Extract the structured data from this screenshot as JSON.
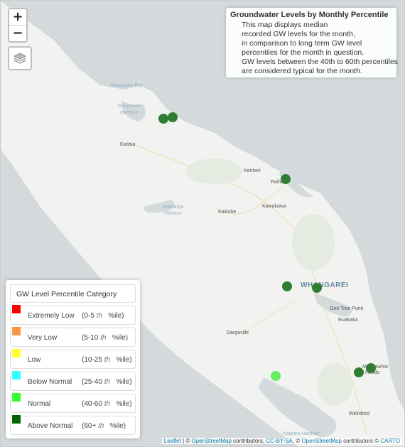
{
  "map": {
    "zoom_in": "+",
    "zoom_out": "−",
    "layers_icon": "layers-icon",
    "places": {
      "rangaunu_bay": "Rangaunu Bay",
      "rangaunu_harbour_1": "Rangaunu",
      "rangaunu_harbour_2": "Harbour",
      "kaitaia": "Kaitaia",
      "kerikeri": "Kerikeri",
      "paihia": "Paihia",
      "kawakawa": "Kawakawa",
      "kaikohe": "Kaikohe",
      "hokianga_harbour_1": "Hokianga",
      "hokianga_harbour_2": "Harbour",
      "whangarei": "WHANGAREI",
      "one_tree_point": "One Tree Point",
      "ruakaka": "Ruakaka",
      "dargaville": "Dargaville",
      "mangawhai_heads_1": "Mangawhai",
      "mangawhai_heads_2": "Heads",
      "wellsford": "Wellsford",
      "kaipara_harbour": "Kaipara Harbour"
    }
  },
  "info": {
    "title": "Groundwater Levels by Monthly Percentile",
    "lines": [
      "This map displays median",
      "recorded GW levels for the month,",
      "in comparison to long term GW level",
      "percentiles for the month in question.",
      "GW levels between the 40th to 60th percentiles",
      "are considered typical for the month."
    ]
  },
  "legend": {
    "title": "GW Level Percentile Category",
    "items": [
      {
        "label": "Extremely Low",
        "range_a": "(0-5",
        "range_th": "th",
        "range_b": "%ile)",
        "color": "#ff0000"
      },
      {
        "label": "Very Low",
        "range_a": "(5-10",
        "range_th": "th",
        "range_b": "%ile)",
        "color": "#f79646"
      },
      {
        "label": "Low",
        "range_a": "(10-25",
        "range_th": "th",
        "range_b": "%ile)",
        "color": "#ffff33"
      },
      {
        "label": "Below Normal",
        "range_a": "(25-40",
        "range_th": "th",
        "range_b": "%ile)",
        "color": "#33ffff"
      },
      {
        "label": "Normal",
        "range_a": "(40-60",
        "range_th": "th",
        "range_b": "%ile)",
        "color": "#33ff33"
      },
      {
        "label": "Above Normal",
        "range_a": "(60+",
        "range_th": "th",
        "range_b": "%ile)",
        "color": "#006400"
      }
    ]
  },
  "sites": [
    {
      "category": "Above Normal",
      "color": "#2e7d32"
    },
    {
      "category": "Above Normal",
      "color": "#2e7d32"
    },
    {
      "category": "Above Normal",
      "color": "#2e7d32"
    },
    {
      "category": "Above Normal",
      "color": "#2e7d32"
    },
    {
      "category": "Above Normal",
      "color": "#2e7d32"
    },
    {
      "category": "Above Normal",
      "color": "#2e7d32"
    },
    {
      "category": "Above Normal",
      "color": "#2e7d32"
    },
    {
      "category": "Normal",
      "color": "#66ee66"
    }
  ],
  "attribution": {
    "leaflet": "Leaflet",
    "sep1": " | © ",
    "osm1": "OpenStreetMap",
    "contrib1": " contributors, ",
    "ccbysa": "CC-BY-SA",
    "sep2": ", © ",
    "osm2": "OpenStreetMap",
    "contrib2": " contributors © ",
    "carto": "CARTO"
  }
}
